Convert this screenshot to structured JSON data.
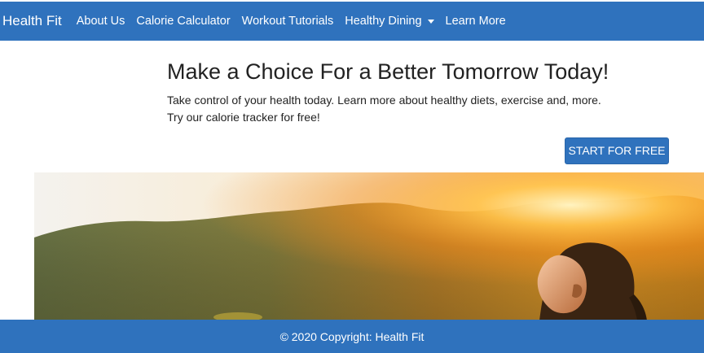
{
  "nav": {
    "brand": "Health Fit",
    "items": [
      {
        "label": "About Us"
      },
      {
        "label": "Calorie Calculator"
      },
      {
        "label": "Workout Tutorials"
      },
      {
        "label": "Healthy Dining"
      },
      {
        "label": "Learn More"
      }
    ]
  },
  "hero": {
    "title": "Make a Choice For a Better Tomorrow Today!",
    "line1": "Take control of your health today. Learn more about healthy diets, exercise and, more.",
    "line2": "Try our calorie tracker for free!",
    "cta_label": "START FOR FREE"
  },
  "footer": {
    "text": "© 2020 Copyright: Health Fit"
  },
  "colors": {
    "brand_blue": "#2f72bd",
    "text": "#222222"
  }
}
